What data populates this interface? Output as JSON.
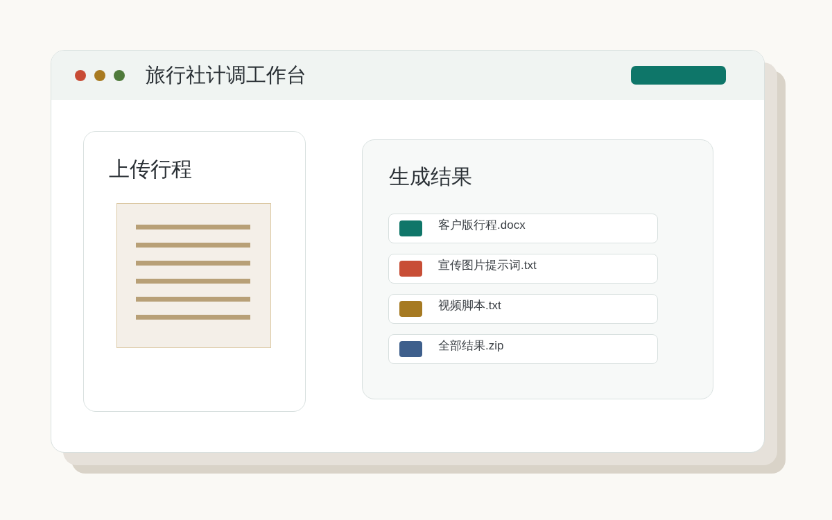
{
  "window": {
    "title": "旅行社计调工作台",
    "window_controls": [
      {
        "color": "#c84b35"
      },
      {
        "color": "#a87a20"
      },
      {
        "color": "#4f7a3b"
      }
    ]
  },
  "upload_panel": {
    "title": "上传行程"
  },
  "results_panel": {
    "title": "生成结果",
    "files": [
      {
        "name": "客户版行程.docx",
        "color": "#0f7669"
      },
      {
        "name": "宣传图片提示词.txt",
        "color": "#c84e36"
      },
      {
        "name": "视频脚本.txt",
        "color": "#a67a22"
      },
      {
        "name": "全部结果.zip",
        "color": "#3e5f8c"
      }
    ]
  }
}
